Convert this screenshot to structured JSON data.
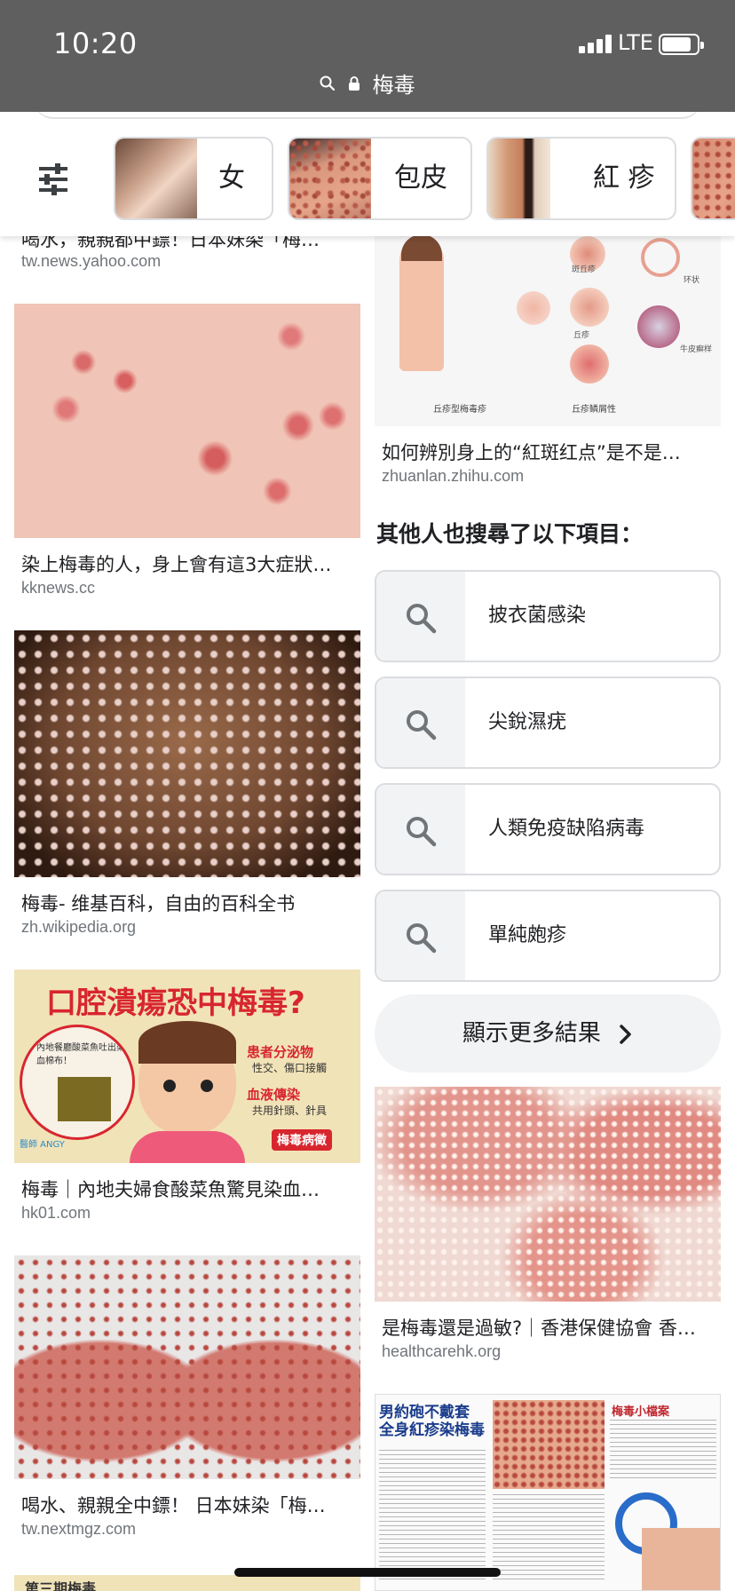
{
  "status": {
    "time": "10:20",
    "network": "LTE"
  },
  "url": {
    "query": "梅毒"
  },
  "chips": [
    {
      "label": "女"
    },
    {
      "label": "包皮"
    },
    {
      "label": "紅 疹"
    }
  ],
  "results_left": [
    {
      "title": "喝水，親親都中鏢！日本妹染「梅…",
      "site": "tw.news.yahoo.com"
    },
    {
      "title": "染上梅毒的人，身上會有這3大症狀…",
      "site": "kknews.cc"
    },
    {
      "title": "梅毒- 维基百科，自由的百科全书",
      "site": "zh.wikipedia.org"
    },
    {
      "title": "梅毒｜內地夫婦食酸菜魚驚見染血…",
      "site": "hk01.com",
      "image_text": {
        "headline": "口腔潰瘍恐中梅毒?",
        "bubble": "內地餐廳酸菜魚吐出染血棉布！",
        "point1": "患者分泌物",
        "point1_sub": "性交、傷口接觸",
        "point2": "血液傳染",
        "point2_sub": "共用針頭、針具",
        "tag": "梅毒病徵",
        "brand": "醫師 ANGY"
      }
    },
    {
      "title": "喝水、親親全中鏢！ 日本妹染「梅…",
      "site": "tw.nextmgz.com"
    },
    {
      "title": "第三期梅毒",
      "site": ""
    }
  ],
  "results_right": [
    {
      "title": "如何辨別身上的“紅斑红点”是不是…",
      "site": "zhuanlan.zhihu.com",
      "image_text": {
        "caption_left": "丘疹型梅毒疹",
        "caption_right": "丘疹鳞屑性",
        "labels": [
          "斑丘疹",
          "环状",
          "丘疹",
          "牛皮癣样"
        ]
      }
    },
    {
      "title": "是梅毒還是過敏?｜香港保健協會 香…",
      "site": "healthcarehk.org"
    },
    {
      "title": "",
      "site": "",
      "image_text": {
        "headline": "男約砲不戴套 全身紅疹染梅毒",
        "box_title": "梅毒小檔案"
      }
    }
  ],
  "related": {
    "heading": "其他人也搜尋了以下項目：",
    "items": [
      "披衣菌感染",
      "尖銳濕疣",
      "人類免疫缺陷病毒",
      "單純皰疹"
    ],
    "more_label": "顯示更多結果"
  },
  "colors": {
    "topbar": "#5f5f5f",
    "chip_border": "#dadce0",
    "site_text": "#70757a",
    "button_bg": "#f1f3f4"
  }
}
